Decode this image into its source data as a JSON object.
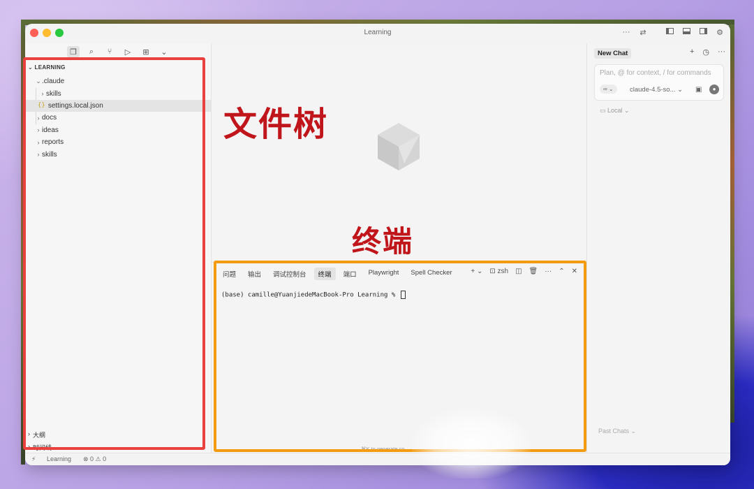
{
  "window": {
    "title": "Learning"
  },
  "sidebar": {
    "root": "LEARNING",
    "tree": [
      {
        "label": ".claude",
        "expanded": true,
        "depth": 1
      },
      {
        "label": "skills",
        "expanded": false,
        "depth": 2
      },
      {
        "label": "settings.local.json",
        "file": true,
        "depth": 2,
        "selected": true
      },
      {
        "label": "docs",
        "expanded": false,
        "depth": 1
      },
      {
        "label": "ideas",
        "expanded": false,
        "depth": 1
      },
      {
        "label": "reports",
        "expanded": false,
        "depth": 1
      },
      {
        "label": "skills",
        "expanded": false,
        "depth": 1
      }
    ],
    "outline": "大纲",
    "timeline": "时间线"
  },
  "terminal": {
    "tabs": [
      "问题",
      "输出",
      "调试控制台",
      "终端",
      "端口",
      "Playwright",
      "Spell Checker"
    ],
    "active_tab": "终端",
    "shell": "zsh",
    "prompt": "(base) camille@YuanjiedeMacBook-Pro Learning % ",
    "hint": "⌘K to generate co"
  },
  "chat": {
    "tab": "New Chat",
    "placeholder": "Plan, @ for context, / for commands",
    "mode": "∞ ⌄",
    "model": "claude-4.5-so... ⌄",
    "location": "Local ⌄",
    "past": "Past Chats ⌄"
  },
  "status": {
    "workspace": "Learning",
    "problems": "⊗ 0 ⚠ 0"
  },
  "annotations": {
    "tree": "文件树",
    "terminal": "终端"
  },
  "colors": {
    "annotation_red": "#e8413e",
    "annotation_orange": "#f39c12",
    "label_red": "#c0151b"
  }
}
